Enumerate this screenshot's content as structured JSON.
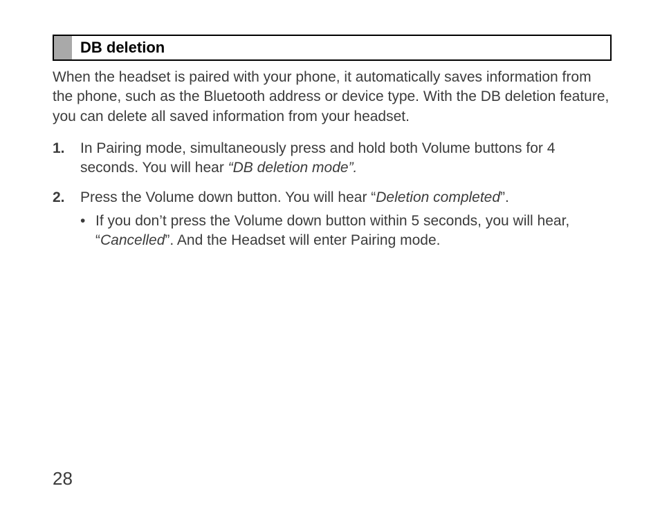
{
  "section": {
    "title": "DB deletion",
    "intro": "When the headset is paired with your phone, it automatically saves information from the phone, such as the Bluetooth address or device type. With the DB deletion feature, you can delete all saved information from your headset."
  },
  "steps": [
    {
      "num": "1.",
      "text_before": "In Pairing mode, simultaneously press and hold both Volume buttons for 4 seconds. You will hear ",
      "quoted_italic": "“DB deletion mode”.",
      "text_after": ""
    },
    {
      "num": "2.",
      "text_before": "Press the Volume down button. You will hear “",
      "quoted_italic": "Deletion completed",
      "text_after": "”.",
      "sub": {
        "bullet": "•",
        "text_before": "If you don’t press the Volume down button within 5 seconds, you will hear, “",
        "quoted_italic": "Cancelled",
        "text_after": "”. And the Headset will enter Pairing mode."
      }
    }
  ],
  "page_number": "28"
}
